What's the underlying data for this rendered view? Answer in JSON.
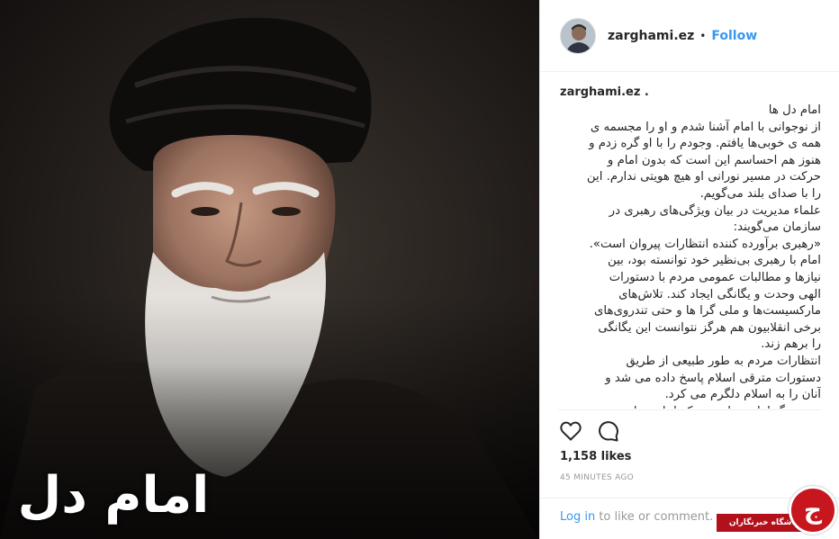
{
  "photo": {
    "caption": "امام دل ها",
    "icon": "portrait-image"
  },
  "header": {
    "username": "zarghami.ez",
    "separator": "•",
    "follow_label": "Follow"
  },
  "caption": {
    "username": "zarghami.ez .",
    "lines": [
      "امام دل ها",
      "از نوجوانی با امام آشنا شدم و او را مجسمه ی",
      "همه ی خوبی‌ها یافتم. وجودم را با او گره زدم و",
      "هنوز هم احساسم این است که بدون امام و",
      "حرکت در مسیر نورانی او هیچ هویتی ندارم. این",
      "را با صدای بلند می‌گویم.",
      "علماء مدیریت در بیان ویژگی‌های رهبری در",
      "سازمان می‌گویند:",
      "«رهبری برآورده کننده انتظارات پیروان است».",
      "امام با رهبری بی‌نظیر خود توانسته بود، بین",
      "نیازها و مطالبات عمومی مردم با دستورات",
      "الهی وحدت و یگانگی ایجاد کند. تلاش‌های",
      "مارکسیست‌ها و ملی گرا ها و حتی تندروی‌های",
      "برخی انقلابیون هم هرگز نتوانست این یگانگی",
      "را برهم زند.",
      "انتظارات مردم به طور طبیعی از طریق",
      "دستورات مترقی اسلام پاسخ داده می شد و",
      "آنان را به اسلام دلگرم می کرد.",
      "هنر بزرگ امام در این بود که اجازه نداد مردم"
    ]
  },
  "actions": {
    "like_icon": "heart-icon",
    "comment_icon": "comment-icon"
  },
  "likes": "1,158 likes",
  "timestamp": "45 MINUTES AGO",
  "footer": {
    "login_label": "Log in",
    "rest": " to like or comment."
  },
  "watermark": {
    "label": "باشگاه خبرنگاران",
    "badge_char": "ج"
  },
  "colors": {
    "link": "#3897f0",
    "text": "#262626",
    "muted": "#999999",
    "watermark_red": "#c8161e"
  }
}
